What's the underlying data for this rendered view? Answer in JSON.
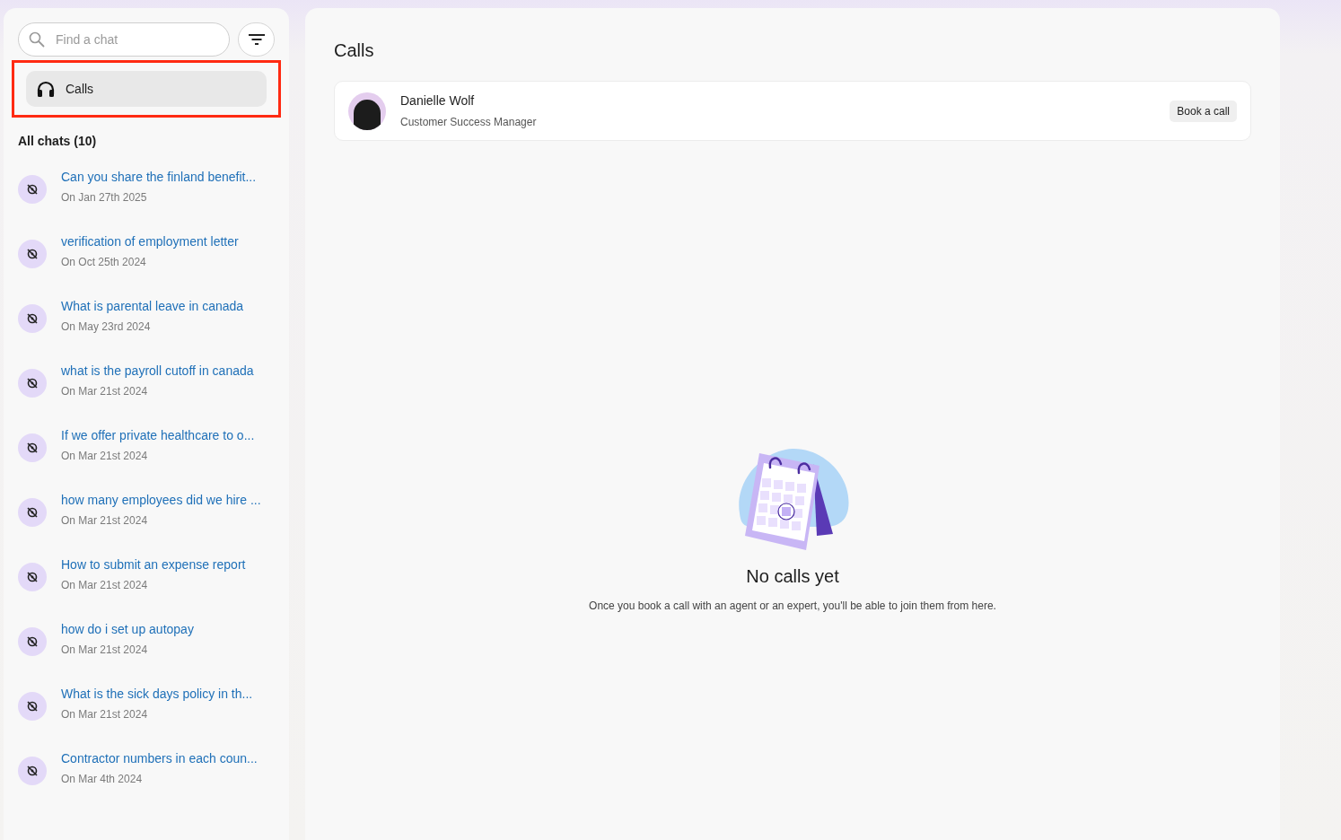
{
  "sidebar": {
    "search": {
      "placeholder": "Find a chat"
    },
    "nav_items": [
      {
        "label": "Calls",
        "selected": true,
        "highlighted": true
      }
    ],
    "chats_heading": "All chats (10)",
    "chats": [
      {
        "title": "Can you share the finland benefit...",
        "date": "On Jan 27th 2025"
      },
      {
        "title": "verification of employment letter",
        "date": "On Oct 25th 2024"
      },
      {
        "title": "What is parental leave in canada",
        "date": "On May 23rd 2024"
      },
      {
        "title": "what is the payroll cutoff in canada",
        "date": "On Mar 21st 2024"
      },
      {
        "title": "If we offer private healthcare to o...",
        "date": "On Mar 21st 2024"
      },
      {
        "title": "how many employees did we hire ...",
        "date": "On Mar 21st 2024"
      },
      {
        "title": "How to submit an expense report",
        "date": "On Mar 21st 2024"
      },
      {
        "title": "how do i set up autopay",
        "date": "On Mar 21st 2024"
      },
      {
        "title": "What is the sick days policy in th...",
        "date": "On Mar 21st 2024"
      },
      {
        "title": "Contractor numbers in each coun...",
        "date": "On Mar 4th 2024"
      }
    ]
  },
  "main": {
    "title": "Calls",
    "contact": {
      "name": "Danielle Wolf",
      "role": "Customer Success Manager",
      "button": "Book a call"
    },
    "empty_state": {
      "title": "No calls yet",
      "text": "Once you book a call with an agent or an expert, you'll be able to join them from here."
    }
  }
}
